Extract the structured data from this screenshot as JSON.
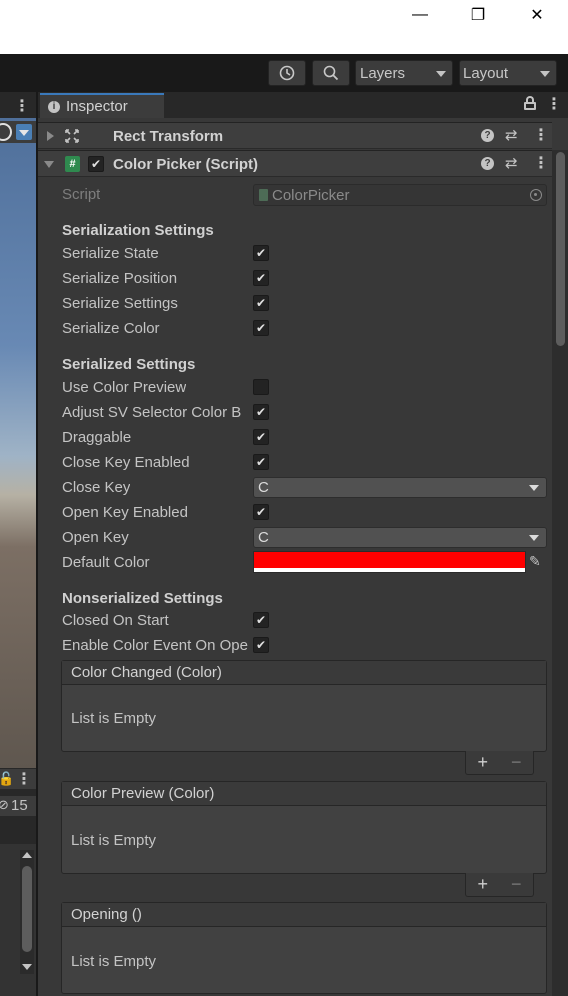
{
  "window": {
    "minimize_glyph": "—",
    "maximize_glyph": "❐",
    "close_glyph": "✕"
  },
  "toolbar": {
    "history_icon": "history-icon",
    "search_icon": "search-icon",
    "layers_label": "Layers",
    "layout_label": "Layout"
  },
  "left_panel": {
    "count": "15"
  },
  "inspector": {
    "tab_label": "Inspector",
    "components": {
      "rect_transform": "Rect Transform",
      "color_picker": "Color Picker (Script)"
    },
    "script": {
      "label": "Script",
      "value": "ColorPicker"
    },
    "serialization": {
      "title": "Serialization Settings",
      "fields": [
        {
          "label": "Serialize State",
          "checked": true
        },
        {
          "label": "Serialize Position",
          "checked": true
        },
        {
          "label": "Serialize Settings",
          "checked": true
        },
        {
          "label": "Serialize Color",
          "checked": true
        }
      ]
    },
    "serialized": {
      "title": "Serialized Settings",
      "use_color_preview": "Use Color Preview",
      "adjust_sv": "Adjust SV Selector Color B",
      "draggable": "Draggable",
      "close_key_enabled": "Close Key Enabled",
      "close_key": "Close Key",
      "close_key_value": "C",
      "open_key_enabled": "Open Key Enabled",
      "open_key": "Open Key",
      "open_key_value": "C",
      "default_color": "Default Color",
      "default_color_value": "#ff0000"
    },
    "nonserialized": {
      "title": "Nonserialized Settings",
      "closed_on_start": "Closed On Start",
      "enable_color_event": "Enable Color Event On Ope"
    },
    "events": [
      {
        "title": "Color Changed (Color)",
        "empty": "List is Empty"
      },
      {
        "title": "Color Preview (Color)",
        "empty": "List is Empty"
      },
      {
        "title": "Opening ()",
        "empty": "List is Empty"
      }
    ],
    "plus": "+",
    "minus": "−"
  },
  "colors": {
    "accent": "#3a79bb",
    "panel": "#383838",
    "header": "#3e3e3e"
  }
}
